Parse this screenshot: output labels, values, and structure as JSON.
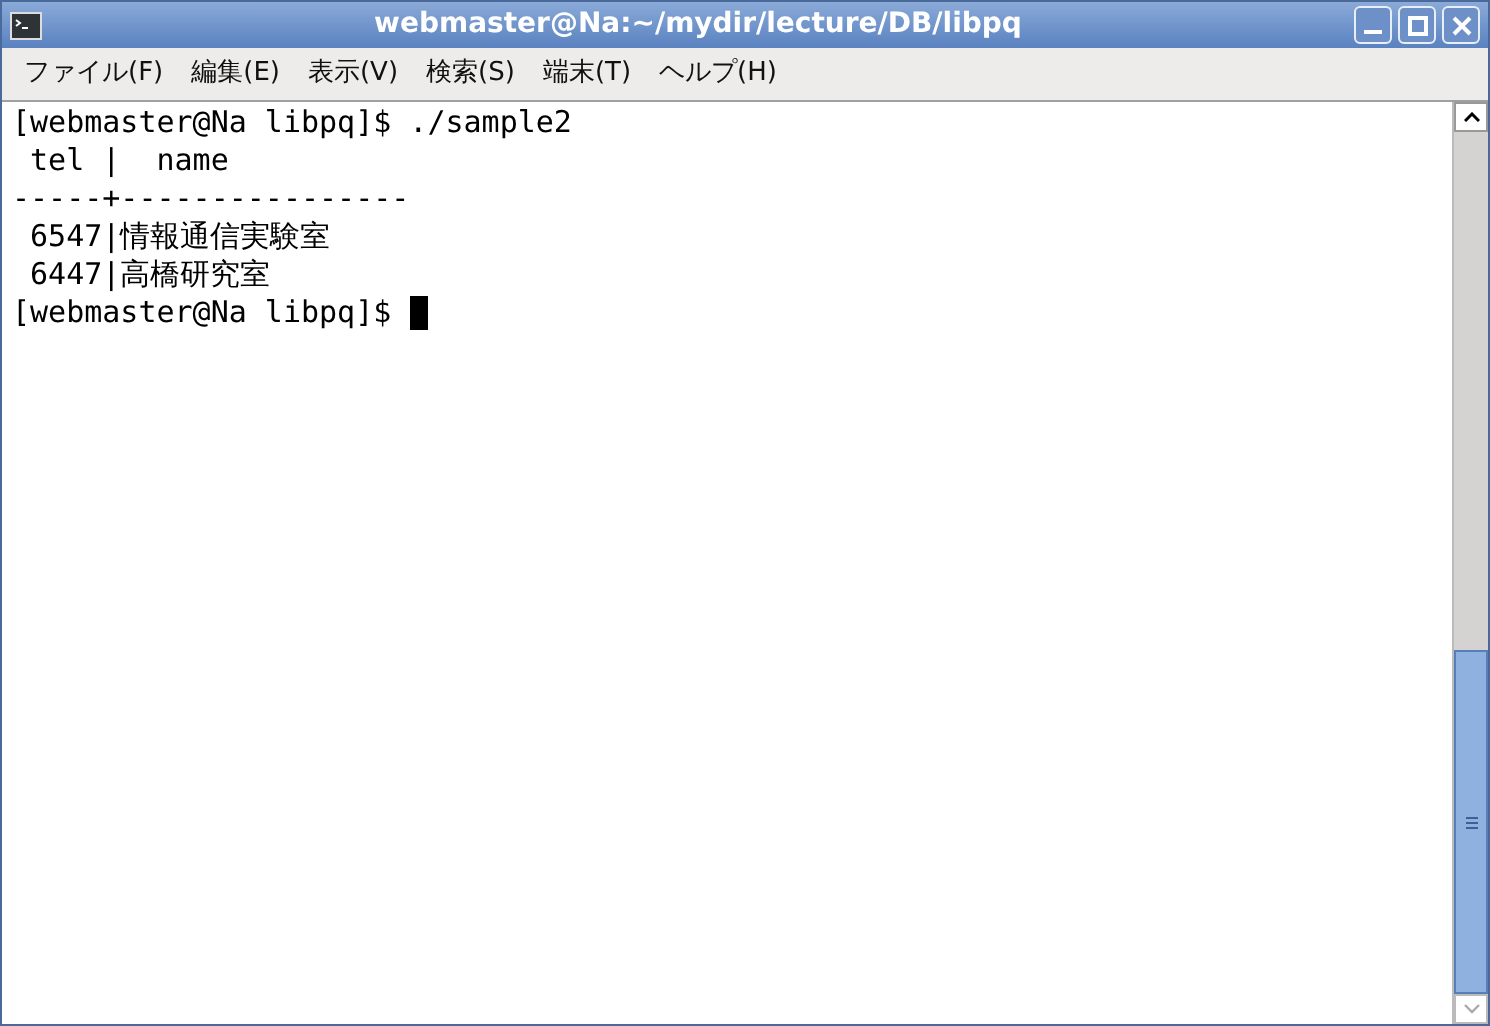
{
  "window": {
    "title": "webmaster@Na:~/mydir/lecture/DB/libpq"
  },
  "menu": [
    "ファイル(F)",
    "編集(E)",
    "表示(V)",
    "検索(S)",
    "端末(T)",
    "ヘルプ(H)"
  ],
  "terminal": {
    "lines": [
      {
        "text": "[webmaster@Na libpq]$ ./sample2",
        "cursor": false
      },
      {
        "text": " tel |  name",
        "cursor": false
      },
      {
        "text": "-----+----------------",
        "cursor": false
      },
      {
        "text": " 6547|情報通信実験室",
        "cursor": false
      },
      {
        "text": " 6447|高橋研究室",
        "cursor": false
      },
      {
        "text": "[webmaster@Na libpq]$",
        "cursor": true
      }
    ]
  }
}
